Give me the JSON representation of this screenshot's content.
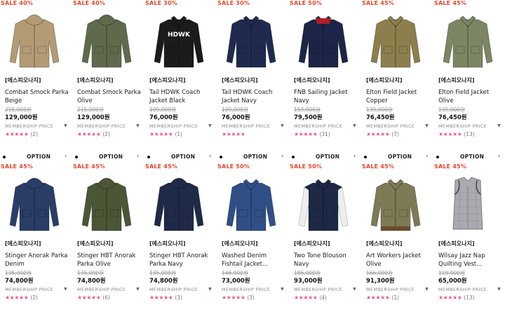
{
  "products": [
    {
      "sale": "SALE 40%",
      "brand": "[에스피오나지]",
      "name": "Combat Smock Parka Beige",
      "original_price": "215,000원",
      "price": "129,000원",
      "member_label": "MEMBERSHIP PRICE",
      "stars": "★★★★★",
      "reviews": "(2)",
      "icon": "parka-icon",
      "color": "#b39b74"
    },
    {
      "sale": "SALE 40%",
      "brand": "[에스피오나지]",
      "name": "Combat Smock Parka Olive",
      "original_price": "215,000원",
      "price": "129,000원",
      "member_label": "MEMBERSHIP PRICE",
      "stars": "★★★★★",
      "reviews": "(2)",
      "icon": "parka-icon",
      "color": "#5f6a4c"
    },
    {
      "sale": "SALE 30%",
      "brand": "[에스피오나지]",
      "name": "Tail HDWK Coach Jacket Black",
      "original_price": "109,000원",
      "price": "76,000원",
      "member_label": "MEMBERSHIP PRICE",
      "stars": "★★★★★",
      "reviews": "(1)",
      "icon": "coach-jacket-icon",
      "color": "#1b1b1d",
      "print": "HDWK"
    },
    {
      "sale": "SALE 30%",
      "brand": "[에스피오나지]",
      "name": "Tail HDWK Coach Jacket Navy",
      "original_price": "109,000원",
      "price": "76,000원",
      "member_label": "MEMBERSHIP PRICE",
      "stars": "★★★★★",
      "reviews": "",
      "icon": "coach-jacket-icon",
      "color": "#1f2a4e"
    },
    {
      "sale": "SALE 50%",
      "brand": "[에스피오나지]",
      "name": "FNB Sailing Jacket Navy",
      "original_price": "159,000원",
      "price": "79,500원",
      "member_label": "MEMBERSHIP PRICE",
      "stars": "★★★★★",
      "reviews": "(31)",
      "icon": "sailing-jacket-icon",
      "color": "#1c2547"
    },
    {
      "sale": "SALE 45%",
      "brand": "[에스피오나지]",
      "name": "Elton Field Jacket Copper",
      "original_price": "139,000원",
      "price": "76,450원",
      "member_label": "MEMBERSHIP PRICE",
      "stars": "★★★★★",
      "reviews": "(7)",
      "icon": "field-jacket-icon",
      "color": "#8c7f4d"
    },
    {
      "sale": "SALE 45%",
      "brand": "[에스피오나지]",
      "name": "Elton Field Jacket Olive",
      "original_price": "139,000원",
      "price": "76,450원",
      "member_label": "MEMBERSHIP PRICE",
      "stars": "★★★★★",
      "reviews": "(13)",
      "icon": "field-jacket-icon",
      "color": "#7c8663"
    },
    {
      "sale": "SALE 45%",
      "brand": "[에스피오나지]",
      "name": "Stinger Anorak Parka Denim",
      "original_price": "135,000원",
      "price": "74,800원",
      "member_label": "MEMBERSHIP PRICE",
      "stars": "★★★★★",
      "reviews": "(2)",
      "icon": "anorak-icon",
      "color": "#2a3d66"
    },
    {
      "sale": "SALE 45%",
      "brand": "[에스피오나지]",
      "name": "Stinger HBT Anorak Parka Olive",
      "original_price": "135,000원",
      "price": "74,800원",
      "member_label": "MEMBERSHIP PRICE",
      "stars": "★★★★★",
      "reviews": "(6)",
      "icon": "anorak-icon",
      "color": "#4b5636"
    },
    {
      "sale": "SALE 45%",
      "brand": "[에스피오나지]",
      "name": "Stinger HBT Anorak Parka Navy",
      "original_price": "135,000원",
      "price": "74,800원",
      "member_label": "MEMBERSHIP PRICE",
      "stars": "★★★★★",
      "reviews": "(3)",
      "icon": "anorak-icon",
      "color": "#1f2a48"
    },
    {
      "sale": "SALE 50%",
      "brand": "[에스피오나지]",
      "name": "Washed Denim Fishtail Jacket...",
      "original_price": "146,000원",
      "price": "73,000원",
      "member_label": "MEMBERSHIP PRICE",
      "stars": "★★★★★",
      "reviews": "(3)",
      "icon": "fishtail-parka-icon",
      "color": "#2f4f86"
    },
    {
      "sale": "SALE 50%",
      "brand": "[에스피오나지]",
      "name": "Two Tone Blouson Navy",
      "original_price": "186,000원",
      "price": "93,000원",
      "member_label": "MEMBERSHIP PRICE",
      "stars": "★★★★★",
      "reviews": "(4)",
      "icon": "blouson-icon",
      "color": "#1c2846"
    },
    {
      "sale": "SALE 45%",
      "brand": "[에스피오나지]",
      "name": "Art Workers Jacket Olive",
      "original_price": "166,000원",
      "price": "91,300원",
      "member_label": "MEMBERSHIP PRICE",
      "stars": "★★★★★",
      "reviews": "(1)",
      "icon": "work-jacket-icon",
      "color": "#7d7a55"
    },
    {
      "sale": "SALE 45%",
      "brand": "[에스피오나지]",
      "name": "Wilsay Jazz Nap Quilting Vest...",
      "original_price": "119,000원",
      "price": "65,000원",
      "member_label": "MEMBERSHIP PRICE",
      "stars": "★★★★★",
      "reviews": "(13)",
      "icon": "quilted-vest-icon",
      "color": "#a9abb0"
    }
  ],
  "option_label": "OPTION",
  "option_rows": 7
}
